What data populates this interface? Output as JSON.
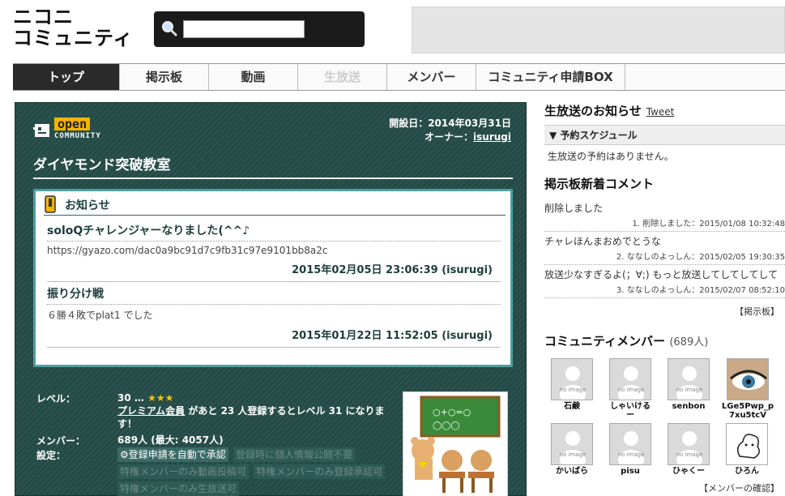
{
  "header": {
    "logo_line1": "ニコニ",
    "logo_line2": "コミュニティ",
    "search_placeholder": "",
    "search_button": "検索"
  },
  "nav": {
    "tabs": [
      {
        "label": "トップ",
        "state": "active"
      },
      {
        "label": "掲示板",
        "state": "normal"
      },
      {
        "label": "動画",
        "state": "normal"
      },
      {
        "label": "生放送",
        "state": "disabled"
      },
      {
        "label": "メンバー",
        "state": "normal"
      },
      {
        "label": "コミュニティ申請BOX",
        "state": "normal"
      }
    ]
  },
  "community": {
    "badge_open": "open",
    "badge_community": "COMMUNITY",
    "opened": "開設日：2014年03月31日",
    "owner_label": "オーナー：",
    "owner_name": "isurugi",
    "title": "ダイヤモンド突破教室"
  },
  "news": {
    "heading": "お知らせ",
    "items": [
      {
        "title": "soloQチャレンジャーなりました(^^♪",
        "body": "https://gyazo.com/dac0a9bc91d7c9fb31c97e9101bb8a2c",
        "date": "2015年02月05日 23:06:39 (isurugi)"
      },
      {
        "title": "振り分け戦",
        "body": "６勝４敗でplat1 でした",
        "date": "2015年01月22日 11:52:05 (isurugi)"
      }
    ]
  },
  "info": {
    "level_label": "レベル：",
    "level_value": "30 …",
    "level_stars": "★★★",
    "premium_link": "プレミアム会員",
    "premium_text_a": "があと",
    "premium_count": "23",
    "premium_text_b": "人登録するとレベル",
    "premium_level": "31",
    "premium_text_c": "になります！",
    "member_label": "メンバー：",
    "member_value": "689人 (最大: 4057人)",
    "settings_label": "設定：",
    "settings": [
      {
        "label": "登録申請を自動で承認",
        "on": true
      },
      {
        "label": "登録時に個人情報公開不要",
        "on": false
      },
      {
        "label": "特権メンバーのみ動画投稿可",
        "on": false
      },
      {
        "label": "特権メンバーのみ登録承認可",
        "on": false
      },
      {
        "label": "特権メンバーのみ生放送可",
        "on": false
      }
    ]
  },
  "right": {
    "live_heading": "生放送のお知らせ",
    "tweet": "Tweet",
    "schedule_bar": "▼ 予約スケジュール",
    "no_live": "生放送の予約はありません。",
    "bbs_heading": "掲示板新着コメント",
    "comments": [
      {
        "text": "削除しました",
        "meta": "1. 削除しました：2015/01/08 10:32:48"
      },
      {
        "text": "チャレほんまおめでとうな",
        "meta": "2. ななしのよっしん：2015/02/05 19:30:35"
      },
      {
        "text": "放送少なすぎるよ(；∀;) もっと放送してしてしてして",
        "meta": "3. ななしのよっしん：2015/02/07 08:52:10"
      }
    ],
    "bbs_link": "【掲示板】",
    "member_heading": "コミュニティメンバー",
    "member_count": "(689人)",
    "members": [
      {
        "name": "石鹸",
        "avatar": "no-image"
      },
      {
        "name": "しゃいけるー",
        "avatar": "no-image"
      },
      {
        "name": "senbon",
        "avatar": "no-image"
      },
      {
        "name": "LGe5Pwp_p7xu5tcV",
        "avatar": "eye"
      },
      {
        "name": "かいばら",
        "avatar": "no-image"
      },
      {
        "name": "pisu",
        "avatar": "no-image"
      },
      {
        "name": "ひゃくー",
        "avatar": "no-image"
      },
      {
        "name": "ひろん",
        "avatar": "drawing"
      }
    ],
    "no_image_label": "no image",
    "member_link": "【メンバーの確認】"
  }
}
